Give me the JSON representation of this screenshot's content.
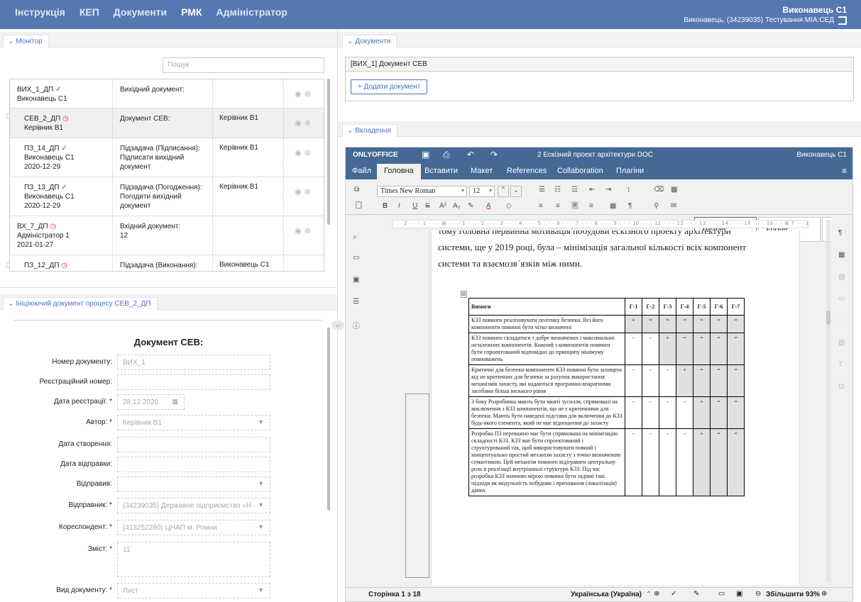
{
  "nav": {
    "items": [
      "Інструкція",
      "КЕП",
      "Документи",
      "РМК",
      "Адміністратор"
    ],
    "active": "РМК"
  },
  "user": {
    "name": "Виконавець С1",
    "org": "Виконавець, (34239035) Тестування МІА:СЕД"
  },
  "monitor": {
    "tab": "Монітор",
    "search_placeholder": "Пошук",
    "rows": [
      {
        "id": "ВИХ_1_ДП",
        "status": "done",
        "who": "Виконавець С1",
        "date": "",
        "type": "Вихідний документ:",
        "desc": "",
        "assignee": ""
      },
      {
        "id": "СЕВ_2_ДП",
        "status": "pending",
        "who": "Керівник В1",
        "date": "",
        "type": "Документ СЕВ:",
        "desc": "",
        "assignee": "Керівник В1"
      },
      {
        "id": "ПЗ_14_ДП",
        "status": "done",
        "who": "Виконавець С1",
        "date": "2020-12-29",
        "type": "Підзадача (Підписання):",
        "desc": "Підписати вихідний документ",
        "assignee": "Керівник В1"
      },
      {
        "id": "ПЗ_13_ДП",
        "status": "done",
        "who": "Виконавець С1",
        "date": "2020-12-29",
        "type": "Підзадача (Погодження):",
        "desc": "Погодити вихідний документ",
        "assignee": "Керівник В1"
      },
      {
        "id": "ВХ_7_ДП",
        "status": "pending",
        "who": "Адміністратор 1",
        "date": "2021-01-27",
        "type": "Вхідний документ:",
        "desc": "12",
        "assignee": ""
      },
      {
        "id": "ПЗ_12_ДП",
        "status": "pending",
        "who": "",
        "date": "",
        "type": "Підзадача (Виконання):",
        "desc": "",
        "assignee": "Виконавець С1"
      }
    ]
  },
  "process": {
    "tab": "Ініціюючий документ процесу СЕВ_2_ДП",
    "title": "Документ СЕВ:",
    "fields": [
      {
        "label": "Номер документу:",
        "value": "ВИХ_1",
        "kind": "text"
      },
      {
        "label": "Реєстраційний номер:",
        "value": "",
        "kind": "text"
      },
      {
        "label": "Дата реєстрації: *",
        "value": "28.12.2020",
        "kind": "date"
      },
      {
        "label": "Автор: *",
        "value": "Керівник В1",
        "kind": "select"
      },
      {
        "label": "Дата створення:",
        "value": "",
        "kind": "text"
      },
      {
        "label": "Дата відправки:",
        "value": "",
        "kind": "text"
      },
      {
        "label": "Відправив:",
        "value": "",
        "kind": "select"
      },
      {
        "label": "Відправник: *",
        "value": "(34239035) Державне підприємство «Н",
        "kind": "select"
      },
      {
        "label": "Кореспондент: *",
        "value": "(413252260) ЦНАП м. Ромни",
        "kind": "select"
      },
      {
        "label": "Зміст: *",
        "value": "11",
        "kind": "textarea"
      },
      {
        "label": "Вид документу: *",
        "value": "Лист",
        "kind": "select"
      }
    ]
  },
  "documents": {
    "tab": "Документи",
    "doc_title": "[ВИХ_1] Документ СЕВ",
    "add_button": "Додати документ"
  },
  "attachments": {
    "tab": "Вкладення"
  },
  "editor": {
    "brand": "ONLYOFFICE",
    "doc_name": "2 Ескізний проект архітектури DOC",
    "user": "Виконавець С1",
    "tabs": [
      "Файл",
      "Головна",
      "Вставити",
      "Макет",
      "References",
      "Collaboration",
      "Плагіни"
    ],
    "active_tab": "Головна",
    "font": "Times New Roman",
    "size": "12",
    "style_header": "Header",
    "style_footer": "Footer",
    "text_line1": "тому головна первинна мотивація побудови ескізного проекту архітектури",
    "text_line2": "системи, ще у 2019 році, була – мінімізація загальної кількості всіх компонент",
    "text_line3": "системи та взаємозв᾽язків між ними.",
    "table": {
      "headers": [
        "Вимоги",
        "Г-1",
        "Г-2",
        "Г-3",
        "Г-4",
        "Г-5",
        "Г-6",
        "Г-7"
      ],
      "rows": [
        {
          "req": "КЗЗ повинен реалізовувати політику безпеки. Всі його компоненти повинні бути чітко визначені",
          "v": [
            "+",
            "=",
            "=",
            "=",
            "=",
            "=",
            "="
          ]
        },
        {
          "req": "КЗЗ повинен складатися з добре визначених і максимально незалежних компонентів. Кожний з компонентів повинен бути спроектований відповідно до принципу мінімуму повноважень",
          "v": [
            "-",
            "-",
            "+",
            "=",
            "=",
            "=",
            "="
          ]
        },
        {
          "req": "Критичні для безпеки компоненти КЗЗ повинні бути захищені від не критичних для безпеки за рахунок використання механізмів захисту, які надаються програмно-апаратними засобами більш низького рівня",
          "v": [
            "-",
            "-",
            "-",
            "+",
            "=",
            "=",
            "="
          ]
        },
        {
          "req": "З боку Розробника мають бути вжиті зусилля, спрямовані на виключення з КЗЗ компонентів, що не є критичними для безпеки. Мають бути наведені підстави для включення до КЗЗ будь-якого елемента, який не має відношення до захисту",
          "v": [
            "-",
            "-",
            "-",
            "-",
            "+",
            "=",
            "="
          ]
        },
        {
          "req": "Розробка ПЗ переважно має бути спрямована на мінімізацію складності КЗЗ. КЗЗ має бути спроектований і структурований так, щоб використовувати повний і концептуально простий механізм захисту з точно визначеною семантикою. Цей механізм повинен відігравати центральну роль в реалізації внутрішньої структури КЗЗ. Під час розробки КЗЗ значною мірою повинні бути задіяні такі підходи як модульність побудови і приховання (локалізація) даних",
          "v": [
            "-",
            "-",
            "-",
            "-",
            "+",
            "=",
            "="
          ]
        }
      ]
    },
    "page_status": "Сторінка 1 з 18",
    "language": "Українська (Україна)",
    "zoom": "Збільшити 93%"
  }
}
